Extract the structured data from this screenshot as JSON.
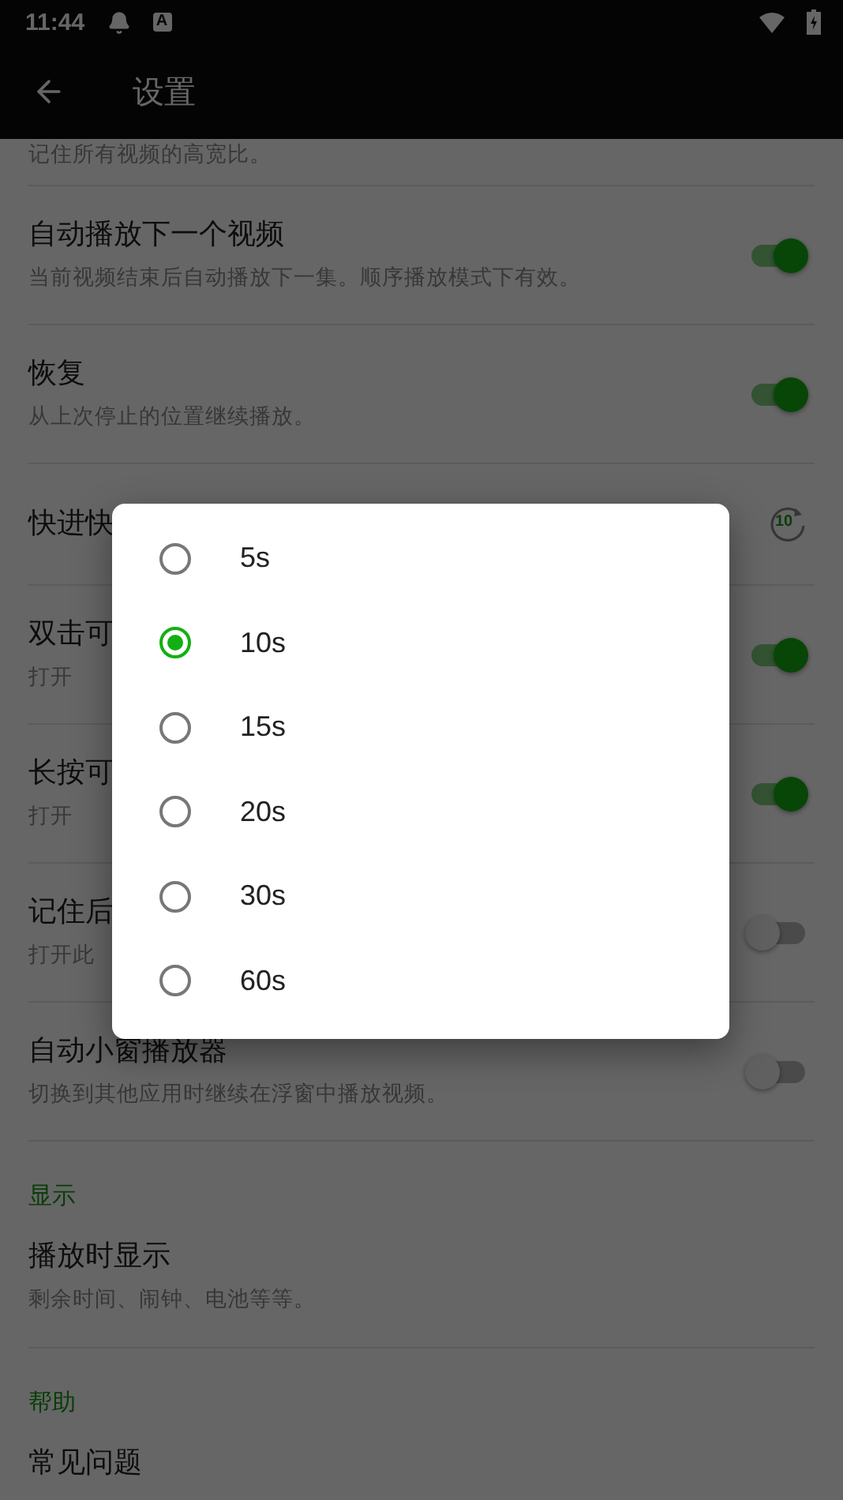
{
  "status_bar": {
    "time": "11:44",
    "badge_letter": "A"
  },
  "app_bar": {
    "title": "设置"
  },
  "settings": [
    {
      "kind": "clipped",
      "subtitle": "记住所有视频的高宽比。"
    },
    {
      "kind": "switch",
      "title": "自动播放下一个视频",
      "subtitle": "当前视频结束后自动播放下一集。顺序播放模式下有效。",
      "on": true
    },
    {
      "kind": "switch",
      "title": "恢复",
      "subtitle": "从上次停止的位置继续播放。",
      "on": true
    },
    {
      "kind": "icon",
      "title": "快进快",
      "icon_text": "10"
    },
    {
      "kind": "switch",
      "title": "双击可",
      "subtitle": "打开",
      "on": true
    },
    {
      "kind": "switch",
      "title": "长按可",
      "subtitle": "打开",
      "on": true
    },
    {
      "kind": "switch",
      "title": "记住后",
      "subtitle": "打开此",
      "on": false
    },
    {
      "kind": "switch",
      "title": "自动小窗播放器",
      "subtitle": "切换到其他应用时继续在浮窗中播放视频。",
      "on": false
    },
    {
      "kind": "header",
      "title": "显示"
    },
    {
      "kind": "plain",
      "title": "播放时显示",
      "subtitle": "剩余时间、闹钟、电池等等。"
    },
    {
      "kind": "header",
      "title": "帮助"
    },
    {
      "kind": "plain",
      "title": "常见问题"
    }
  ],
  "dialog": {
    "options": [
      {
        "label": "5s",
        "selected": false
      },
      {
        "label": "10s",
        "selected": true
      },
      {
        "label": "15s",
        "selected": false
      },
      {
        "label": "20s",
        "selected": false
      },
      {
        "label": "30s",
        "selected": false
      },
      {
        "label": "60s",
        "selected": false
      }
    ]
  }
}
